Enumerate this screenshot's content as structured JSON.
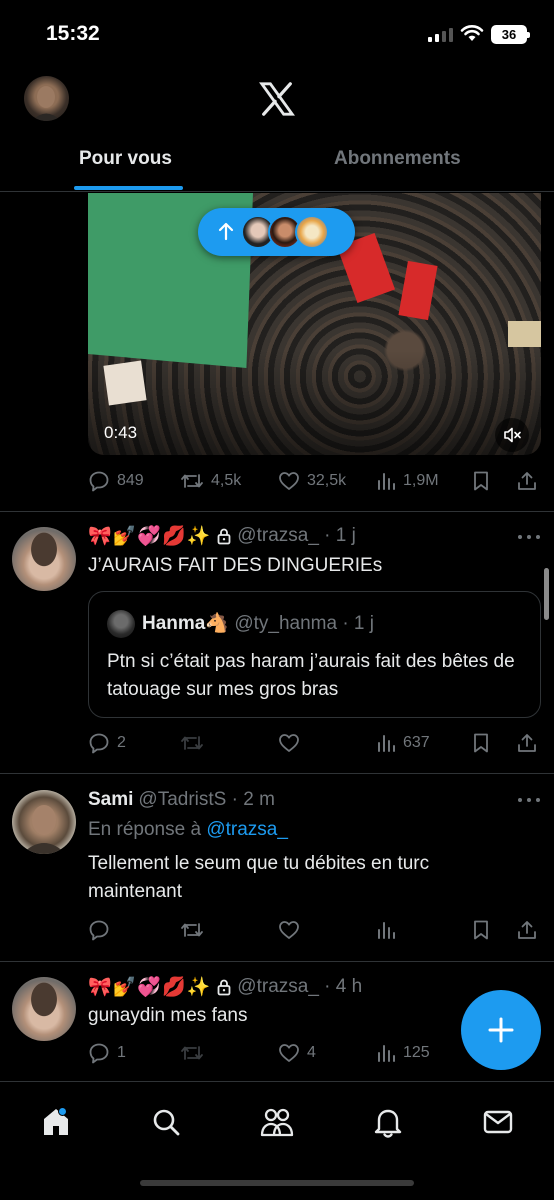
{
  "status_bar": {
    "time": "15:32",
    "battery": "36"
  },
  "header": {
    "tabs": [
      {
        "label": "Pour vous",
        "active": true
      },
      {
        "label": "Abonnements",
        "active": false
      }
    ]
  },
  "video": {
    "duration": "0:43"
  },
  "tweet_video_stats": {
    "replies": "849",
    "reposts": "4,5k",
    "likes": "32,5k",
    "views": "1,9M"
  },
  "tweet1": {
    "emojis": "🎀💅💞💋✨",
    "handle": "@trazsa_ · 1 j",
    "text": "J’AURAIS FAIT DES DINGUERIEs",
    "quote": {
      "name": "Hanma",
      "name_emoji": "🐴",
      "handle": "@ty_hanma · 1 j",
      "text": "Ptn si c’était pas haram j’aurais fait des bêtes de tatouage sur mes gros bras"
    },
    "stats": {
      "replies": "2",
      "reposts": "",
      "likes": "",
      "views": "637"
    }
  },
  "tweet2": {
    "name": "Sami",
    "handle": "@TadristS · 2 m",
    "reply_prefix": "En réponse à",
    "reply_to": "@trazsa_",
    "text": "Tellement le seum que tu débites en turc maintenant",
    "stats": {
      "replies": "",
      "reposts": "",
      "likes": "",
      "views": ""
    }
  },
  "tweet3": {
    "emojis": "🎀💅💞💋✨",
    "handle": "@trazsa_ · 4 h",
    "text": "gunaydin mes fans",
    "stats": {
      "replies": "1",
      "reposts": "",
      "likes": "4",
      "views": "125"
    }
  },
  "colors": {
    "accent": "#1d9bf0",
    "background": "#000000",
    "muted": "#71767b",
    "text": "#e7e9ea"
  },
  "icons": {
    "nav": [
      "home-icon",
      "search-icon",
      "communities-icon",
      "notifications-icon",
      "messages-icon"
    ],
    "actions": [
      "reply-icon",
      "repost-icon",
      "like-icon",
      "views-icon",
      "bookmark-icon",
      "share-icon"
    ]
  }
}
